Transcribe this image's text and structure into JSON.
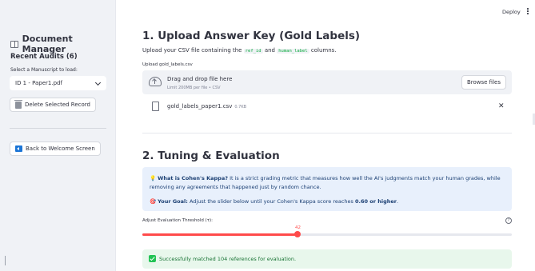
{
  "header": {
    "deploy_label": "Deploy"
  },
  "sidebar": {
    "title": "Document Manager",
    "recent_audits": "Recent Audits (6)",
    "select_label": "Select a Manuscript to load:",
    "selected_value": "ID 1 - Paper1.pdf",
    "delete_button": "Delete Selected Record",
    "back_button": "Back to Welcome Screen"
  },
  "upload": {
    "heading": "1. Upload Answer Key (Gold Labels)",
    "desc_pre": "Upload your CSV file containing the",
    "code1": "ref_id",
    "desc_mid": "and",
    "code2": "human_label",
    "desc_post": "columns.",
    "field_label": "Upload gold_labels.csv",
    "dropzone_title": "Drag and drop file here",
    "dropzone_sub": "Limit 200MB per file • CSV",
    "browse_button": "Browse files",
    "file_name": "gold_labels_paper1.csv",
    "file_size": "0.7KB"
  },
  "tuning": {
    "heading": "2. Tuning & Evaluation",
    "info_bold": "What is Cohen's Kappa?",
    "info_text": "It is a strict grading metric that measures how well the AI's judgments match your human grades, while removing any agreements that happened just by random chance.",
    "goal_bold": "Your Goal:",
    "goal_text": "Adjust the slider below until your Cohen's Kappa score reaches",
    "goal_value": "0.60 or higher",
    "goal_end": ".",
    "slider_label": "Adjust Evaluation Threshold (τ):",
    "slider_value": "42",
    "slider_fraction": 0.42,
    "success_text": "Successfully matched 104 references for evaluation."
  },
  "colors": {
    "accent": "#ff4b4b",
    "info_bg": "#e8f0fc",
    "success_bg": "#e8f7ec"
  }
}
